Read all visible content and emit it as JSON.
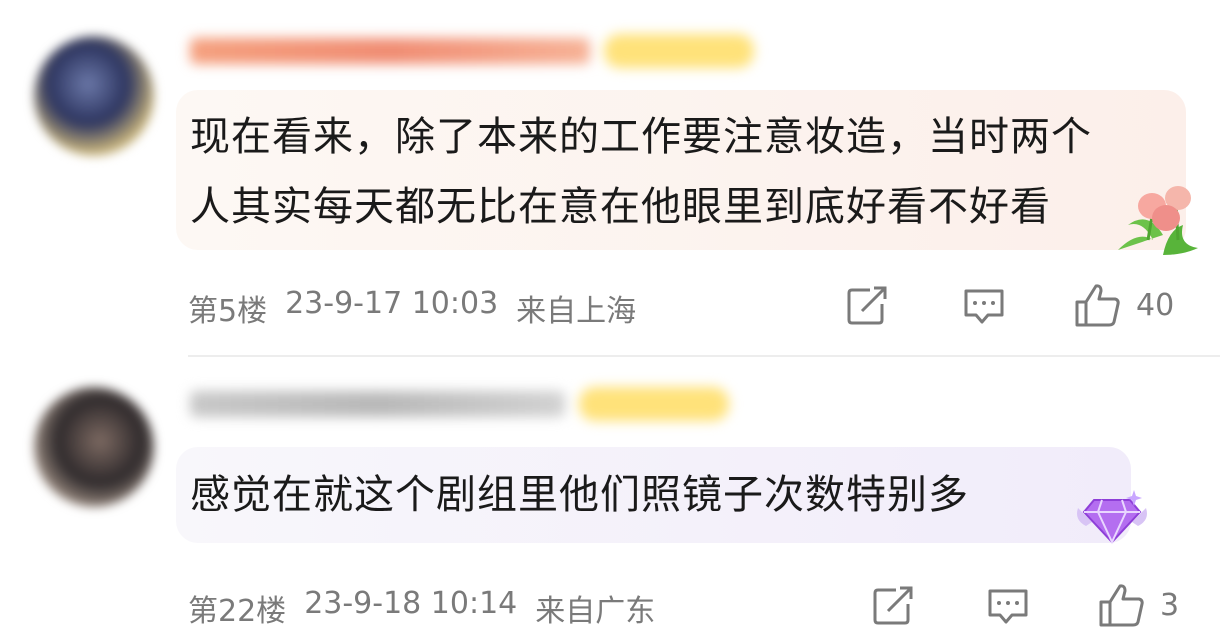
{
  "comments": [
    {
      "text_line1": "现在看来，除了本来的工作要注意妆造，当时两个",
      "text_line2": "人其实每天都无比在意在他眼里到底好看不好看",
      "floor": "第5楼",
      "datetime": "23-9-17 10:03",
      "location": "来自上海",
      "likes": "40"
    },
    {
      "text_line1": "感觉在就这个剧组里他们照镜子次数特别多",
      "floor": "第22楼",
      "datetime": "23-9-18 10:14",
      "location": "来自广东",
      "likes": "3"
    }
  ],
  "icons": {
    "share": "edit-share-icon",
    "reply": "comment-icon",
    "like": "thumbs-up-icon",
    "decor1": "tulip-flowers-icon",
    "decor2": "purple-gem-icon"
  },
  "colors": {
    "meta_text": "#7a7a7a",
    "bubble1": "#fcefea",
    "bubble2": "#f1ecfa"
  }
}
